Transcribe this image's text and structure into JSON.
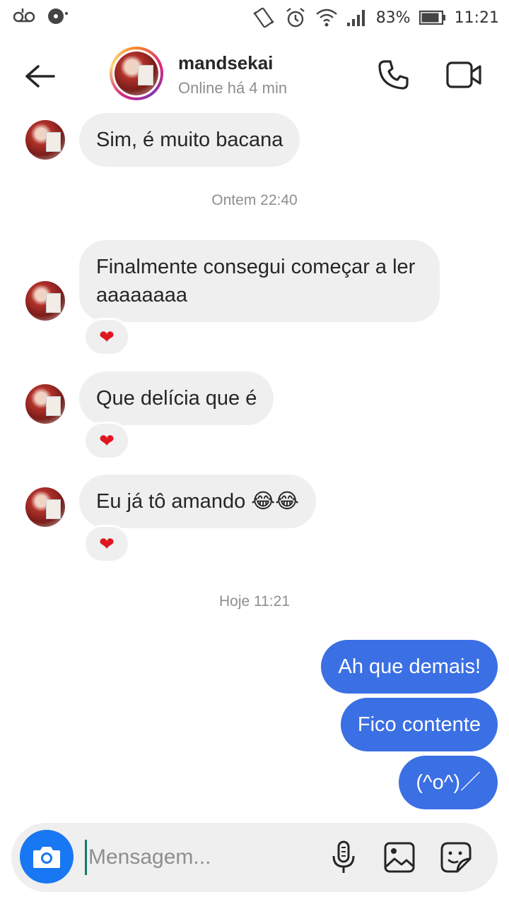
{
  "status_bar": {
    "battery": "83%",
    "time": "11:21",
    "icons": [
      "voicemail-icon",
      "media-icon",
      "vibrate-icon",
      "alarm-icon",
      "wifi-icon",
      "signal-icon",
      "battery-icon"
    ]
  },
  "header": {
    "username": "mandsekai",
    "status": "Online há 4 min",
    "icons": [
      "back-arrow-icon",
      "phone-icon",
      "video-icon"
    ]
  },
  "conversation": {
    "timestamps": [
      "Ontem 22:40",
      "Hoje 11:21"
    ],
    "incoming": [
      {
        "text": "Sim, é muito bacana"
      },
      {
        "text": "Finalmente consegui começar a ler aaaaaaaa",
        "reaction": "❤"
      },
      {
        "text": "Que delícia que é",
        "reaction": "❤"
      },
      {
        "text": "Eu já tô amando 😂😂",
        "reaction": "❤"
      }
    ],
    "outgoing": [
      {
        "text": "Ah que demais!"
      },
      {
        "text": "Fico contente"
      },
      {
        "text": "(^o^)／"
      }
    ]
  },
  "composer": {
    "placeholder": "Mensagem...",
    "icons": [
      "camera-icon",
      "microphone-icon",
      "gallery-icon",
      "sticker-icon"
    ]
  },
  "colors": {
    "outgoing_bubble": "#3b6fe4",
    "incoming_bubble": "#efefef",
    "camera_button": "#1877f2",
    "reaction_heart": "#e0161e"
  }
}
